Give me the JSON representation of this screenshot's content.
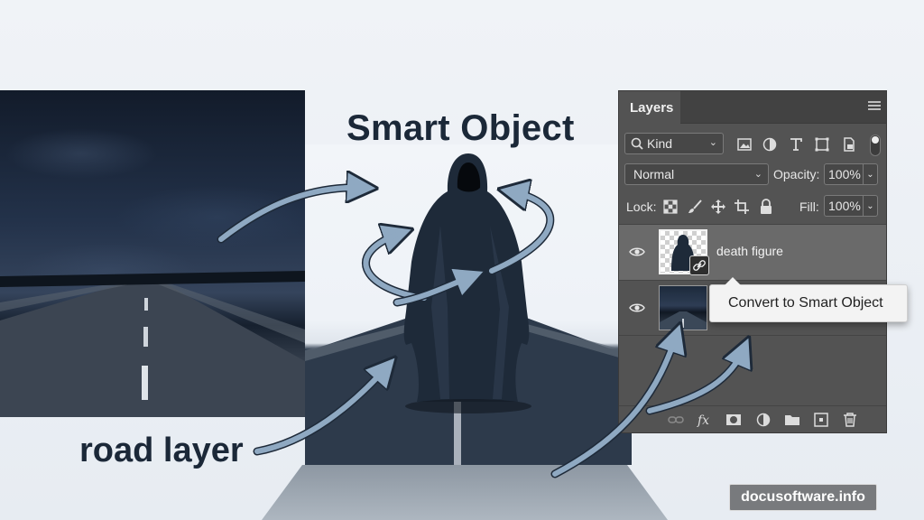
{
  "labels": {
    "smart_object": "Smart Object",
    "road_layer": "road layer"
  },
  "panel": {
    "tab_label": "Layers",
    "kind_filter": "Kind",
    "blend_mode": "Normal",
    "opacity_label": "Opacity:",
    "opacity_value": "100%",
    "lock_label": "Lock:",
    "fill_label": "Fill:",
    "fill_value": "100%",
    "layers": [
      {
        "name": "death figure",
        "visible": true,
        "selected": true,
        "smart_object_badge": true
      },
      {
        "name": "",
        "visible": true,
        "selected": false
      }
    ],
    "filter_icons": [
      "image-filter-icon",
      "adjustment-filter-icon",
      "type-filter-icon",
      "shape-filter-icon",
      "smart-object-filter-icon"
    ],
    "lock_icons": [
      "lock-transparent-icon",
      "lock-image-icon",
      "lock-position-icon",
      "lock-artboard-icon",
      "lock-all-icon"
    ],
    "bottom_icons": [
      "link-layers-icon",
      "fx-icon",
      "mask-icon",
      "adjustment-layer-icon",
      "group-folder-icon",
      "new-layer-icon",
      "trash-icon"
    ]
  },
  "context_menu": {
    "item": "Convert to Smart Object"
  },
  "watermark": "docusoftware.info",
  "colors": {
    "panel_bg": "#535353",
    "selected_row": "#6a6a6a",
    "arrow_fill": "#8fa9c2",
    "text_dark": "#1b2838"
  }
}
